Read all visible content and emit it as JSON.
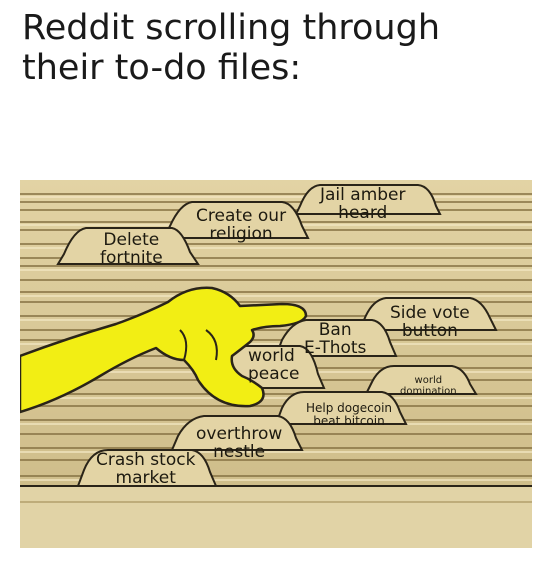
{
  "meme": {
    "caption_line1": "Reddit scrolling through",
    "caption_line2": "their to-do files:",
    "tabs": [
      {
        "id": "delete-fortnite",
        "line1": "Delete",
        "line2": "fortnite"
      },
      {
        "id": "create-religion",
        "line1": "Create our",
        "line2": "religion"
      },
      {
        "id": "jail-amber-heard",
        "line1": "Jail amber",
        "line2": "heard"
      },
      {
        "id": "side-vote-button",
        "line1": "Side vote",
        "line2": "button"
      },
      {
        "id": "ban-ethots",
        "line1": "Ban",
        "line2": "E-Thots"
      },
      {
        "id": "world-peace",
        "line1": "world",
        "line2": "peace"
      },
      {
        "id": "world-domination",
        "line1": "world",
        "line2": "domination"
      },
      {
        "id": "help-dogecoin",
        "line1": "Help dogecoin",
        "line2": "beat bitcoin"
      },
      {
        "id": "overthrow-nestle",
        "line1": "overthrow",
        "line2": "nestle"
      },
      {
        "id": "crash-stock-market",
        "line1": "Crash stock",
        "line2": "market"
      }
    ]
  },
  "colors": {
    "folder_light": "#e6d8ab",
    "folder_mid": "#cdb97f",
    "folder_dark": "#9a8653",
    "hand_yellow": "#f2ee14",
    "outline": "#2a2418"
  },
  "icons": [
    "pointing-hand-icon"
  ]
}
